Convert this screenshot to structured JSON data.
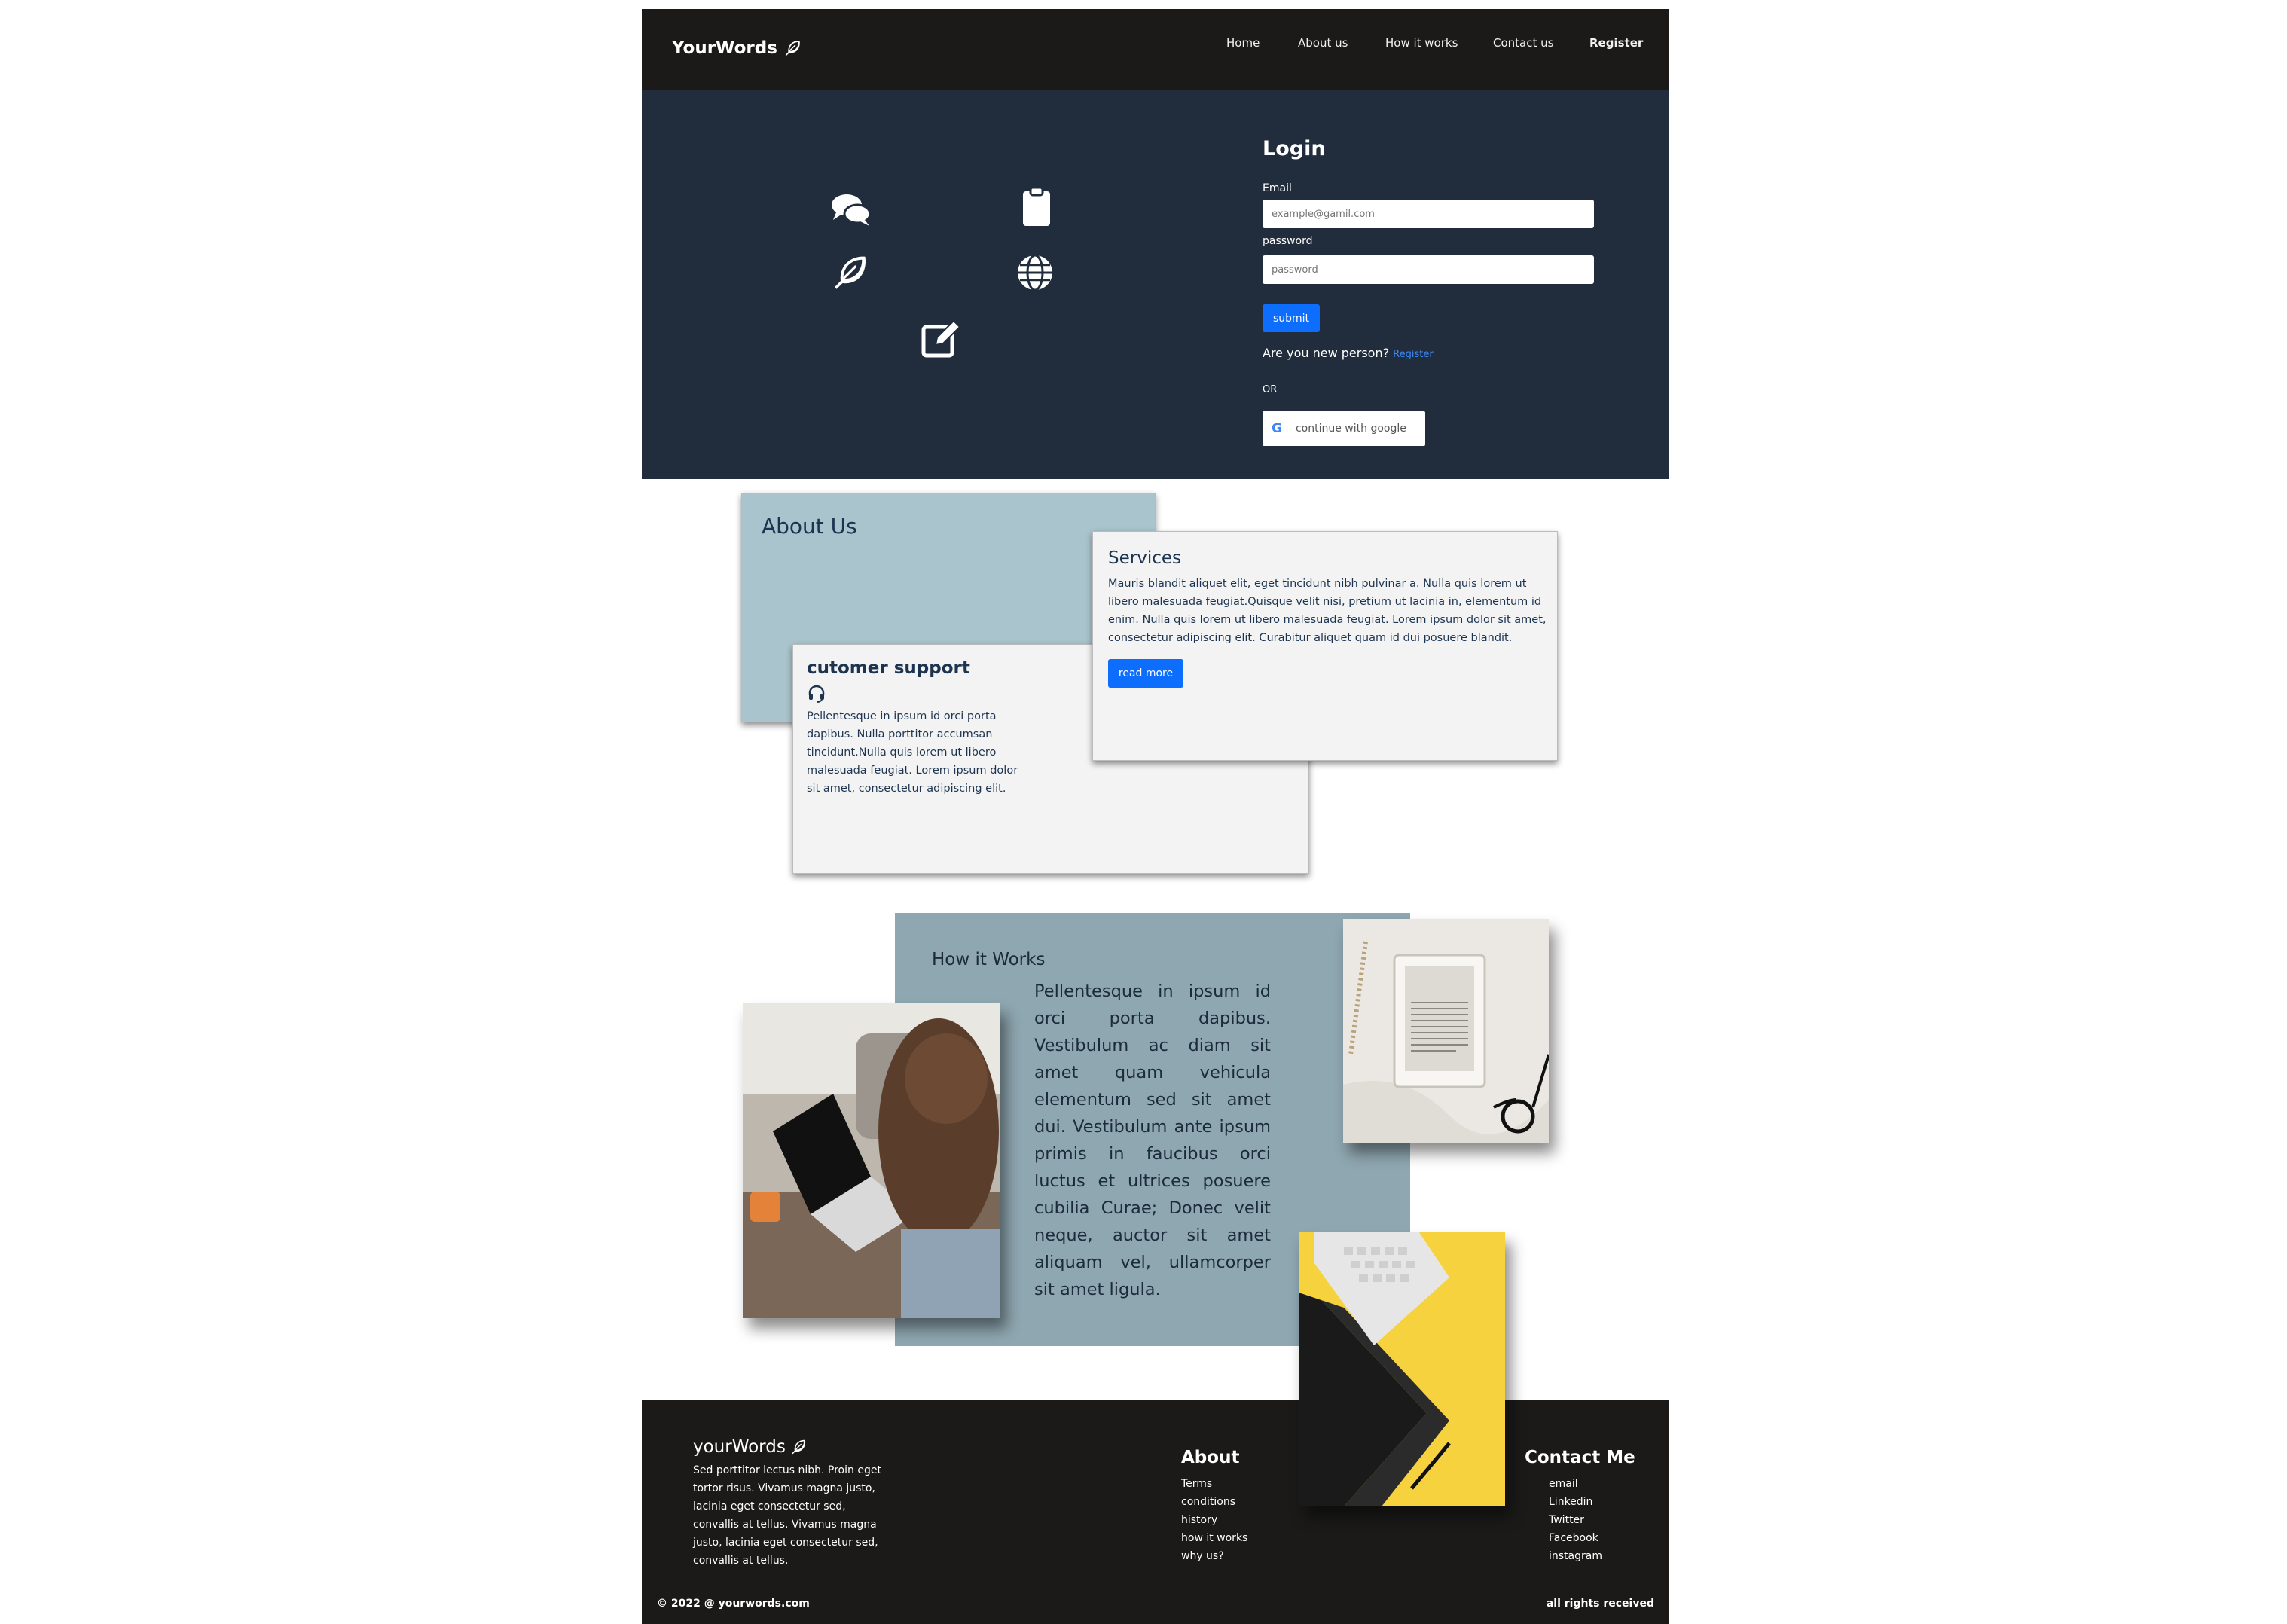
{
  "navbar": {
    "brand": "YourWords",
    "links": [
      "Home",
      "About us",
      "How it works",
      "Contact us"
    ],
    "register": "Register"
  },
  "hero": {
    "icons": [
      "chat-icon",
      "clipboard-icon",
      "feather-icon",
      "globe-icon",
      "edit-icon"
    ]
  },
  "login": {
    "title": "Login",
    "email_label": "Email",
    "email_placeholder": "example@gamil.com",
    "password_label": "password",
    "password_placeholder": "password",
    "submit": "submit",
    "new_person": "Are you new person?",
    "register_link": "Register",
    "or": "OR",
    "google": "continue with google"
  },
  "about": {
    "title": "About Us",
    "support_title": "cutomer support",
    "support_text": "Pellentesque in ipsum id orci porta dapibus. Nulla porttitor accumsan tincidunt.Nulla quis lorem ut libero malesuada feugiat. Lorem ipsum dolor sit amet, consectetur adipiscing elit.",
    "services_title": "Services",
    "services_text": "Mauris blandit aliquet elit, eget tincidunt nibh pulvinar a. Nulla quis lorem ut libero malesuada feugiat.Quisque velit nisi, pretium ut lacinia in, elementum id enim. Nulla quis lorem ut libero malesuada feugiat. Lorem ipsum dolor sit amet, consectetur adipiscing elit. Curabitur aliquet quam id dui posuere blandit.",
    "read_more": "read more"
  },
  "how": {
    "title": "How it Works",
    "text": "Pellentesque in ipsum id orci porta dapibus. Vestibulum ac diam sit amet quam vehicula elementum sed sit amet dui. Vestibulum ante ipsum primis in faucibus orci luctus et ultrices posuere cubilia Curae; Donec velit neque, auctor sit amet aliquam vel, ullamcorper sit amet ligula."
  },
  "footer": {
    "brand": "yourWords",
    "desc": "Sed porttitor lectus nibh. Proin eget tortor risus. Vivamus magna justo, lacinia eget consectetur sed, convallis at tellus. Vivamus magna justo, lacinia eget consectetur sed, convallis at tellus.",
    "about_heading": "About",
    "about_links": [
      "Terms",
      "conditions",
      "history",
      "how it works",
      "why us?"
    ],
    "contact_heading": "Contact Me",
    "contact_links": [
      "email",
      "Linkedin",
      "Twitter",
      "Facebook",
      "instagram"
    ],
    "copyright": "© 2022 @ yourwords.com",
    "rights": "all rights received"
  },
  "colors": {
    "navbar_bg": "#1b1a19",
    "hero_bg": "#212d3c",
    "accent": "#0d6efd",
    "about_card": "#a9c4cc",
    "how_bg": "#8fa7b1"
  }
}
